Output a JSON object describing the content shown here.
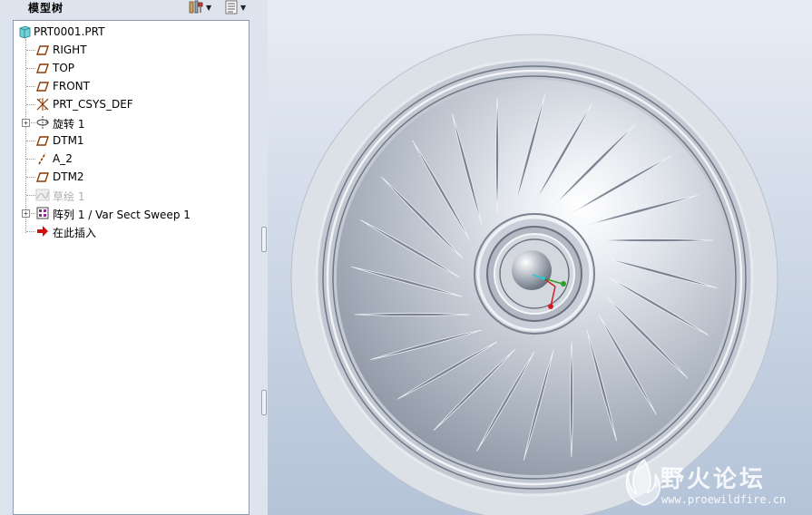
{
  "panel": {
    "title": "模型树",
    "tools": [
      {
        "icon": "settings-tools-icon"
      },
      {
        "icon": "tree-filter-icon"
      }
    ]
  },
  "tree": {
    "items": [
      {
        "label": "PRT0001.PRT",
        "icon": "part-icon",
        "expandable": false,
        "dimmed": false
      },
      {
        "label": "RIGHT",
        "icon": "datum-plane-icon",
        "expandable": false,
        "dimmed": false
      },
      {
        "label": "TOP",
        "icon": "datum-plane-icon",
        "expandable": false,
        "dimmed": false
      },
      {
        "label": "FRONT",
        "icon": "datum-plane-icon",
        "expandable": false,
        "dimmed": false
      },
      {
        "label": "PRT_CSYS_DEF",
        "icon": "coordinate-system-icon",
        "expandable": false,
        "dimmed": false
      },
      {
        "label": "旋转 1",
        "icon": "revolve-icon",
        "expandable": true,
        "dimmed": false
      },
      {
        "label": "DTM1",
        "icon": "datum-plane-icon",
        "expandable": false,
        "dimmed": false
      },
      {
        "label": "A_2",
        "icon": "datum-axis-icon",
        "expandable": false,
        "dimmed": false
      },
      {
        "label": "DTM2",
        "icon": "datum-plane-icon",
        "expandable": false,
        "dimmed": false
      },
      {
        "label": "草绘 1",
        "icon": "sketch-icon",
        "expandable": false,
        "dimmed": true
      },
      {
        "label": "阵列 1 / Var Sect Sweep 1",
        "icon": "pattern-icon",
        "expandable": true,
        "dimmed": false
      },
      {
        "label": "在此插入",
        "icon": "insert-here-arrow-icon",
        "expandable": false,
        "dimmed": false
      }
    ]
  },
  "viewport": {
    "background_top": "#e8edf5",
    "background_bottom": "#b4c3d8",
    "rib_count": 24
  },
  "watermark": {
    "name": "野火论坛",
    "url": "www.proewildfire.cn"
  }
}
